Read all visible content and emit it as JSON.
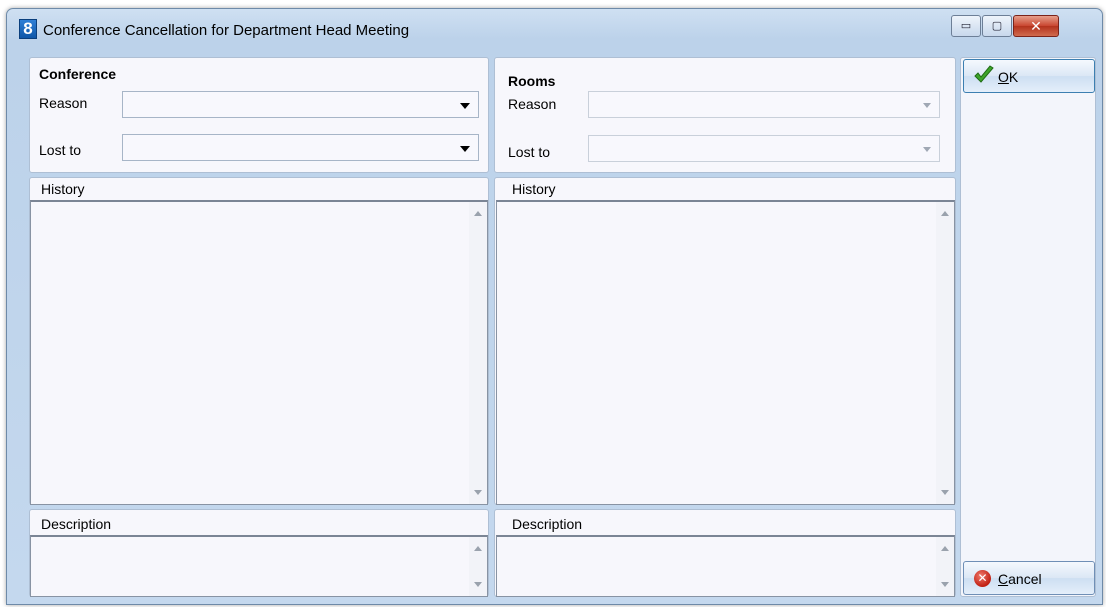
{
  "window": {
    "app_icon_text": "8",
    "title": "Conference Cancellation for Department Head Meeting",
    "controls": {
      "minimize": "▭",
      "maximize": "▢",
      "close": "✕"
    }
  },
  "conference": {
    "heading": "Conference",
    "reason_label": "Reason",
    "reason_value": "",
    "lost_to_label": "Lost to",
    "lost_to_value": "",
    "history_label": "History",
    "history_value": "",
    "description_label": "Description",
    "description_value": ""
  },
  "rooms": {
    "heading": "Rooms",
    "reason_label": "Reason",
    "reason_value": "",
    "lost_to_label": "Lost to",
    "lost_to_value": "",
    "history_label": "History",
    "history_value": "",
    "description_label": "Description",
    "description_value": ""
  },
  "buttons": {
    "ok_mnemonic": "O",
    "ok_rest": "K",
    "cancel_mnemonic": "C",
    "cancel_rest": "ancel"
  },
  "icons": {
    "ok": "green-check-icon",
    "cancel": "red-x-circle-icon",
    "cancel_glyph": "✕"
  }
}
